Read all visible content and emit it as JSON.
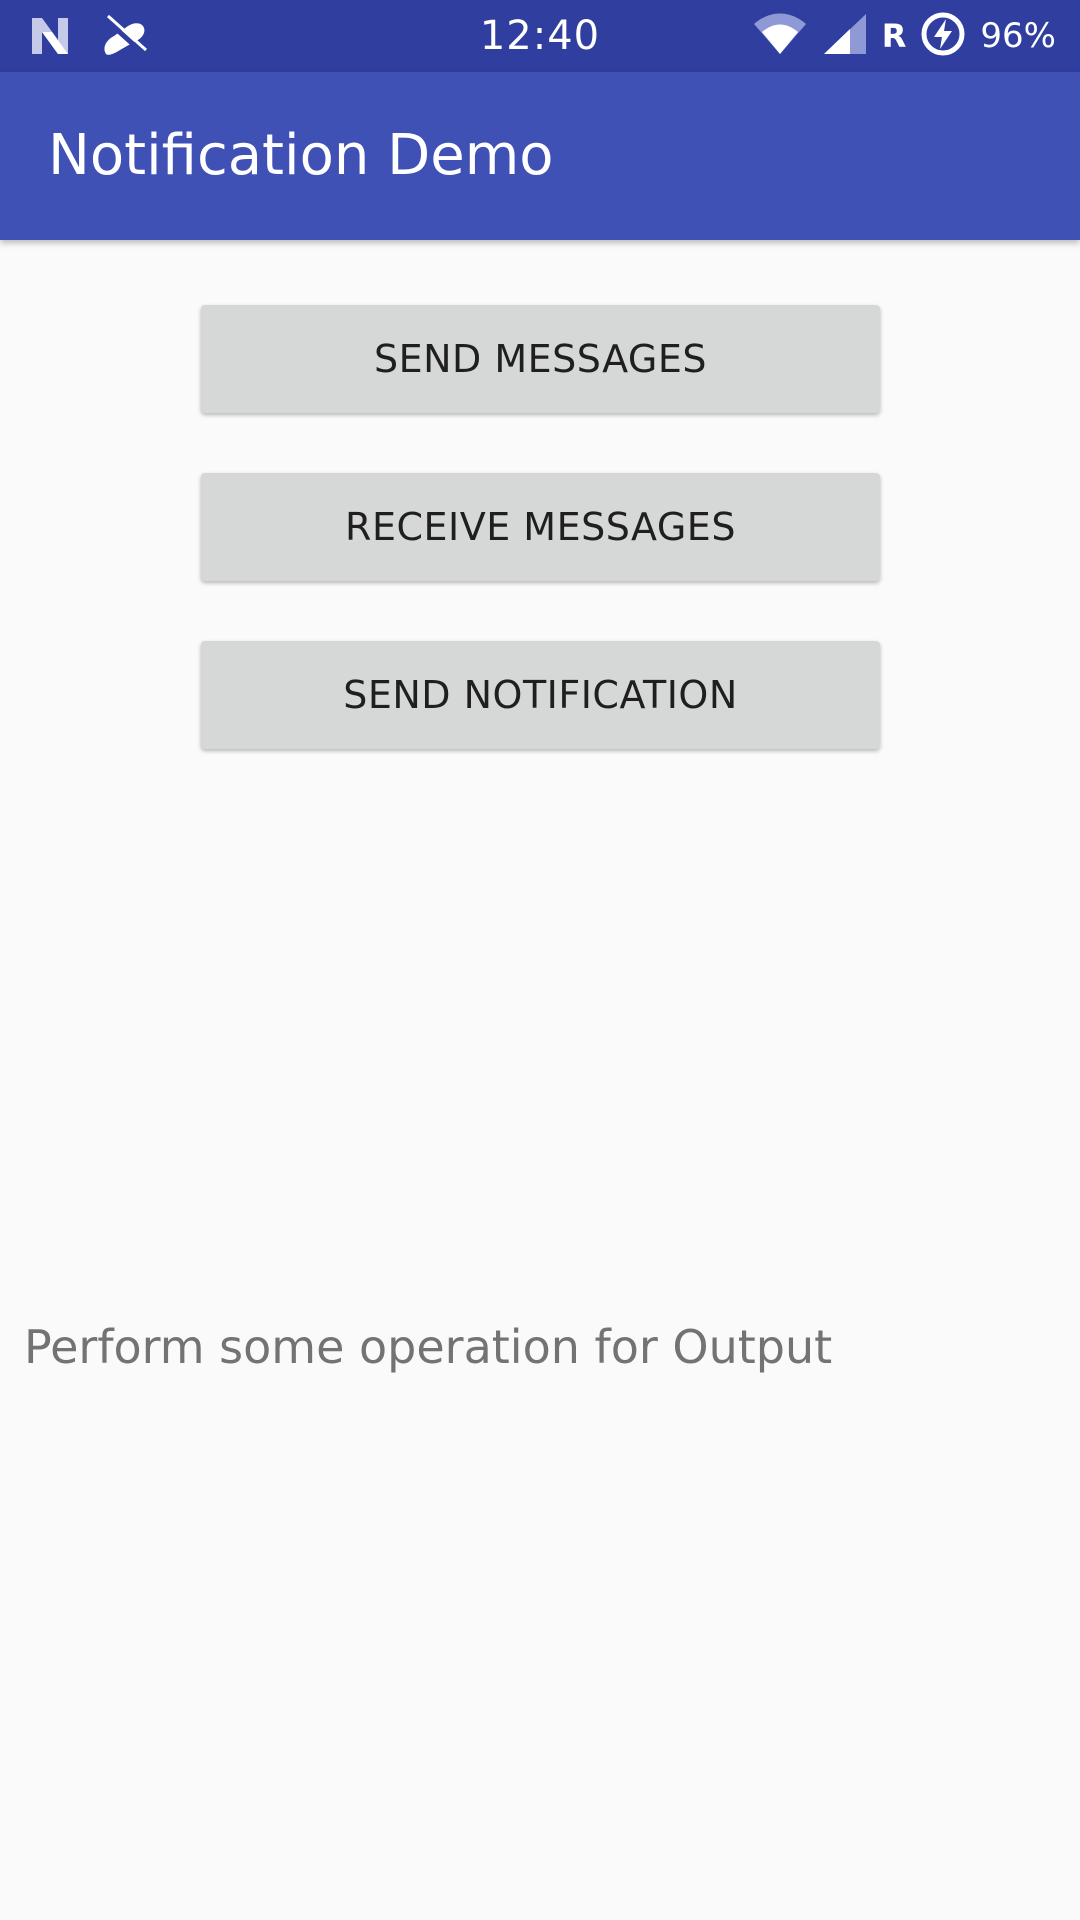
{
  "status_bar": {
    "time": "12:40",
    "battery_percent": "96%",
    "roaming_label": "R",
    "icons": [
      "n-logo-icon",
      "muted-mic-icon",
      "wifi-icon",
      "signal-icon",
      "battery-charging-icon"
    ],
    "color": "#303f9f"
  },
  "app_bar": {
    "title": "Notification Demo",
    "color": "#3f51b5"
  },
  "buttons": {
    "send_messages": "SEND MESSAGES",
    "receive_messages": "RECEIVE MESSAGES",
    "send_notification": "SEND NOTIFICATION"
  },
  "output": {
    "text": "Perform some operation for Output"
  }
}
